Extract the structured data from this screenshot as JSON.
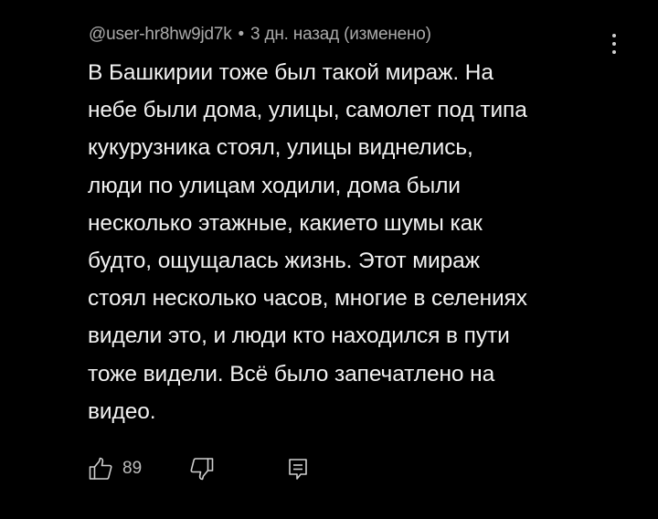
{
  "comment": {
    "author": "@user-hr8hw9jd7k",
    "separator": "•",
    "time": "3 дн. назад (изменено)",
    "text": "В Башкирии тоже был такой мираж.  На\nнебе были дома, улицы, самолет под типа\nкукурузника стоял, улицы виднелись,\nлюди по улицам ходили, дома были\nнесколько этажные, какието шумы как\nбудто, ощущалась жизнь. Этот мираж\nстоял несколько часов, многие в селениях\nвидели это, и люди кто находился в пути\nтоже видели. Всё было запечатлено на\nвидео.",
    "like_count": "89"
  },
  "icons": {
    "more": "more-vertical-icon",
    "like": "thumbs-up-icon",
    "dislike": "thumbs-down-icon",
    "reply": "reply-comment-icon"
  },
  "colors": {
    "background": "#000000",
    "text": "#f1f1f1",
    "meta": "#aaaaaa",
    "icon": "#cfcfcf"
  }
}
